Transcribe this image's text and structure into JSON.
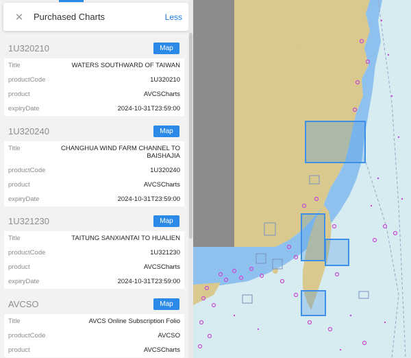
{
  "panel": {
    "title": "Purchased Charts",
    "less_label": "Less",
    "close_icon": "close-icon"
  },
  "charts": [
    {
      "code": "1U320210",
      "map_label": "Map",
      "fields": [
        {
          "label": "Title",
          "value": "WATERS SOUTHWARD OF TAIWAN"
        },
        {
          "label": "productCode",
          "value": "1U320210"
        },
        {
          "label": "product",
          "value": "AVCSCharts"
        },
        {
          "label": "expiryDate",
          "value": "2024-10-31T23:59:00"
        }
      ]
    },
    {
      "code": "1U320240",
      "map_label": "Map",
      "fields": [
        {
          "label": "Title",
          "value": "CHANGHUA WIND FARM CHANNEL TO BAISHAJIA"
        },
        {
          "label": "productCode",
          "value": "1U320240"
        },
        {
          "label": "product",
          "value": "AVCSCharts"
        },
        {
          "label": "expiryDate",
          "value": "2024-10-31T23:59:00"
        }
      ]
    },
    {
      "code": "1U321230",
      "map_label": "Map",
      "fields": [
        {
          "label": "Title",
          "value": "TAITUNG SANXIANTAI TO HUALIEN"
        },
        {
          "label": "productCode",
          "value": "1U321230"
        },
        {
          "label": "product",
          "value": "AVCSCharts"
        },
        {
          "label": "expiryDate",
          "value": "2024-10-31T23:59:00"
        }
      ]
    },
    {
      "code": "AVCSO",
      "map_label": "Map",
      "fields": [
        {
          "label": "Title",
          "value": "AVCS Online Subscription Folio"
        },
        {
          "label": "productCode",
          "value": "AVCSO"
        },
        {
          "label": "product",
          "value": "AVCSCharts"
        }
      ]
    }
  ],
  "colors": {
    "accent": "#2b89e8",
    "land": "#d9c98e",
    "shallow_water": "#8fc1ee",
    "sea": "#d7ecf0",
    "chart_outline": "#3d8fe8"
  }
}
